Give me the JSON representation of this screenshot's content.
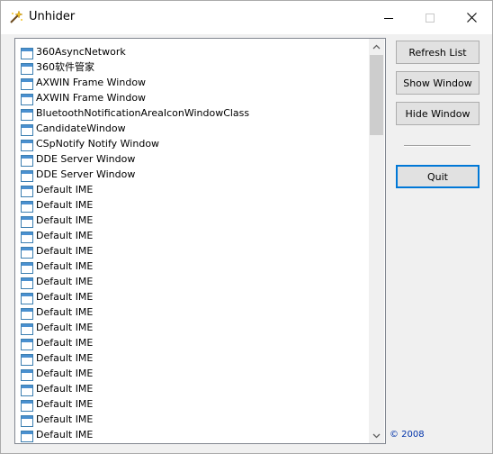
{
  "window": {
    "title": "Unhider"
  },
  "list": {
    "items": [
      "360AsyncNetwork",
      "360软件管家",
      "AXWIN Frame Window",
      "AXWIN Frame Window",
      "BluetoothNotificationAreaIconWindowClass",
      "CandidateWindow",
      "CSpNotify Notify Window",
      "DDE Server Window",
      "DDE Server Window",
      "Default IME",
      "Default IME",
      "Default IME",
      "Default IME",
      "Default IME",
      "Default IME",
      "Default IME",
      "Default IME",
      "Default IME",
      "Default IME",
      "Default IME",
      "Default IME",
      "Default IME",
      "Default IME",
      "Default IME",
      "Default IME",
      "Default IME"
    ]
  },
  "buttons": {
    "refresh": "Refresh List",
    "show": "Show Window",
    "hide": "Hide Window",
    "quit": "Quit"
  },
  "footer": {
    "copyright": "© 2008"
  },
  "icons": {
    "app": "magic-wand-icon",
    "list_item": "window-icon"
  },
  "colors": {
    "accent": "#0078d7",
    "copyright": "#0033aa"
  }
}
